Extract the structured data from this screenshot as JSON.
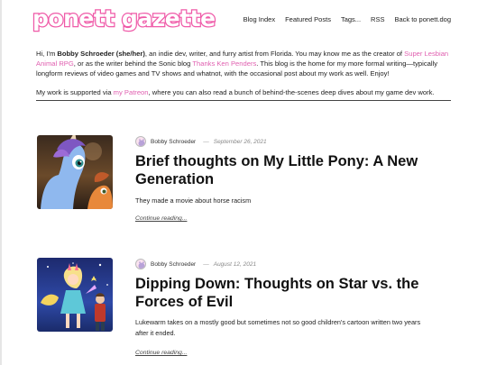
{
  "site": {
    "logo_text": "ponett gazette"
  },
  "nav": {
    "items": [
      {
        "label": "Blog Index"
      },
      {
        "label": "Featured Posts"
      },
      {
        "label": "Tags..."
      },
      {
        "label": "RSS"
      },
      {
        "label": "Back to ponett.dog"
      }
    ]
  },
  "intro": {
    "p1_a": "Hi, I'm ",
    "name": "Bobby Schroeder (she/her)",
    "p1_b": ", an indie dev, writer, and furry artist from Florida. You may know me as the creator of ",
    "link_game": "Super Lesbian Animal RPG",
    "p1_c": ", or as the writer behind the Sonic blog ",
    "link_blog": "Thanks Ken Penders",
    "p1_d": ". This blog is the home for my more formal writing—typically longform reviews of video games and TV shows and whatnot, with the occasional post about my work as well. Enjoy!",
    "p2_a": "My work is supported via ",
    "link_patreon": "my Patreon",
    "p2_b": ", where you can also read a bunch of behind-the-scenes deep dives about my game dev work."
  },
  "posts": [
    {
      "author": "Bobby Schroeder",
      "date": "September 26, 2021",
      "title": "Brief thoughts on My Little Pony: A New Generation",
      "excerpt": "They made a movie about horse racism",
      "read_more": "Continue reading..."
    },
    {
      "author": "Bobby Schroeder",
      "date": "August 12, 2021",
      "title": "Dipping Down: Thoughts on Star vs. the Forces of Evil",
      "excerpt": "Lukewarm takes on a mostly good but sometimes not so good children's cartoon written two years after it ended.",
      "read_more": "Continue reading..."
    }
  ],
  "colors": {
    "accent": "#ef5aa8",
    "link": "#e060b0"
  }
}
